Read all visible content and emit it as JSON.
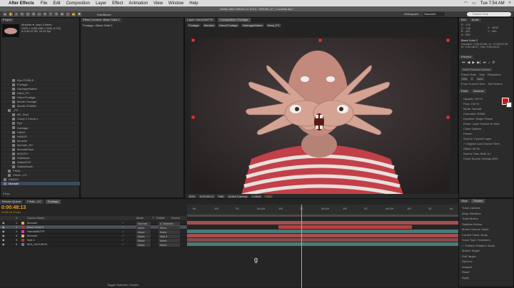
{
  "menu": {
    "app": "After Effects",
    "items": [
      "File",
      "Edit",
      "Composition",
      "Layer",
      "Effect",
      "Animation",
      "View",
      "Window",
      "Help"
    ],
    "time": "Tue 7:54 AM"
  },
  "window_title": "Adobe After Effects CC 2014 - SREAM_07_Coroabilt.aep *",
  "toolbar": {
    "panel_label": "RotoBezier",
    "workspace_label": "Workspace:",
    "workspace_value": "Standard",
    "search_placeholder": "Search Help"
  },
  "project": {
    "tab": "Project",
    "selected": "Monster ▾, used 3 times",
    "dims": "1920 x 1080 (960 x 540) (1.00)",
    "duration": "Δ 0:00:07:08, 24.00 fps",
    "items": [
      {
        "label": "Eye-STABLE",
        "level": 2
      },
      {
        "label": "Footage",
        "level": 2
      },
      {
        "label": "GarbageMatted",
        "level": 2
      },
      {
        "label": "Hand_PC",
        "level": 2
      },
      {
        "label": "Hand-Footage",
        "level": 2
      },
      {
        "label": "Mouth-Footage",
        "level": 2
      },
      {
        "label": "Mouth-STABEL",
        "level": 2
      },
      {
        "label": "_PC",
        "level": 1
      },
      {
        "label": "BC_Shot",
        "level": 2
      },
      {
        "label": "Comp 1 Comp 1",
        "level": 2
      },
      {
        "label": "Eye",
        "level": 2
      },
      {
        "label": "Garbage",
        "level": 2
      },
      {
        "label": "HAND",
        "level": 2
      },
      {
        "label": "HANDS",
        "level": 2
      },
      {
        "label": "Monster",
        "level": 2
      },
      {
        "label": "Monster_PC",
        "level": 2
      },
      {
        "label": "MonsterFace",
        "level": 2
      },
      {
        "label": "MOUTH",
        "level": 2
      },
      {
        "label": "Stabilized",
        "level": 2
      },
      {
        "label": "StableEYE",
        "level": 2
      },
      {
        "label": "StableMouth",
        "level": 2
      },
      {
        "label": "FINAL",
        "level": 1
      },
      {
        "label": "FINAL--CC",
        "level": 1
      },
      {
        "label": "HANDS",
        "level": 0
      },
      {
        "label": "Monster",
        "level": 0
      }
    ],
    "footer": "8 bpc"
  },
  "effects": {
    "tab": "Effect Controls: Black Solid 2",
    "subtitle": "Footage • Black Solid 2"
  },
  "comp": {
    "tabs": [
      "Layer: Hand-MATTE",
      "Composition: Footage"
    ],
    "subtabs": [
      "Footage",
      "Monster",
      "Hand-Footage",
      "GarbageMatted",
      "Hand_PC"
    ],
    "zoom": "50%",
    "timecode": "0:00:48:13",
    "quality": "Half",
    "camera": "Active Camera",
    "views": "1 View",
    "offset": "+0.0"
  },
  "right": {
    "info_tabs": [
      "Info",
      "Audio"
    ],
    "rgb": [
      "R : 176",
      "G : 145",
      "B : 161",
      "A : 255"
    ],
    "xy": [
      "X : 1632",
      "Y : 284"
    ],
    "layer": "Black Solid 2",
    "duration": "Duration: 0:00:00:06, In: +0:00:00:18",
    "inout": "In: 0:00:48:07, Out: 0:00:48:07",
    "preview_tab": "Preview",
    "ram": "RAM Preview Options",
    "frame_rate": "Frame Rate",
    "skip": "Skip",
    "resolution": "Resolution",
    "frame_rate_value": "(24)",
    "skip_value": "0",
    "resolution_value": "Auto",
    "from_current": "From Current Time",
    "full_screen": "Full Screen",
    "paint_tabs": [
      "Paint",
      "Brushes"
    ],
    "paint": [
      "Opacity: 100 %",
      "Flow: 100 %",
      "Mode: Normal",
      "Channels: RGBA",
      "Duration: Single Frame",
      "Erase: Layer Source & Paint",
      "Clone Options",
      "Preset:",
      "Source: Current Layer",
      "✓ Aligned   Lock Source Time",
      "Offset: 00    00",
      "Source Time Shift: 0 f",
      "Clone Source Overlay 50%"
    ],
    "tracker_tabs": [
      "Align",
      "Tracker"
    ],
    "tracker": [
      "Track Camera",
      "Warp Stabilizer",
      "Track Motion",
      "Stabilize Motion",
      "Motion Source: None",
      "Current Track: None",
      "Track Type: Transform",
      "✓ Position  Rotation  Scale",
      "Motion Target:",
      "Edit Target...",
      "Options...",
      "Analyze:",
      "Reset",
      "Apply"
    ]
  },
  "timeline": {
    "tabs": [
      "Render Queue",
      "FINAL--CC",
      "Footage"
    ],
    "timecode": "0:00:48:13",
    "frames": "01165 (24.00 fps)",
    "header": [
      "#",
      "Source Name",
      "Mode",
      "T",
      "TrkMat",
      "Parent"
    ],
    "layers": [
      {
        "num": "1",
        "name": "Monster",
        "color": "#d0b060",
        "mode": "Normal",
        "parent": "4. Monster",
        "sel": false
      },
      {
        "num": "2",
        "name": "Black Solid 2",
        "color": "#c03030",
        "mode": "None",
        "parent": "None",
        "sel": true
      },
      {
        "num": "3",
        "name": "HandsMATTE",
        "color": "#c040c0",
        "mode": "None",
        "parent": "None",
        "sel": false
      },
      {
        "num": "4",
        "name": "Monster",
        "color": "#d0b060",
        "mode": "None",
        "parent": "Null 4",
        "sel": false
      },
      {
        "num": "5",
        "name": "Null 4",
        "color": "#c03030",
        "mode": "None",
        "parent": "None",
        "sel": false
      },
      {
        "num": "6",
        "name": "MVI_0112.MOV",
        "color": "#5080c0",
        "mode": "None",
        "parent": "None",
        "sel": false
      }
    ],
    "ruler": [
      "0s",
      "10f",
      "20",
      "2s:00f",
      "10f",
      "20",
      "3s:00f",
      "10f",
      "20",
      "4s:00f",
      "10f",
      "20",
      "5s"
    ],
    "playhead_fraction": 0.42,
    "footer": "Toggle Switches / Modes",
    "cursor": "g"
  },
  "colors": {
    "accent": "#e8a020",
    "selection": "#3e4a5c",
    "paint_fg": "#e01010"
  },
  "icons": [
    "apple-icon",
    "wifi-icon",
    "battery-icon",
    "search-icon",
    "play-icon",
    "stop-icon"
  ]
}
